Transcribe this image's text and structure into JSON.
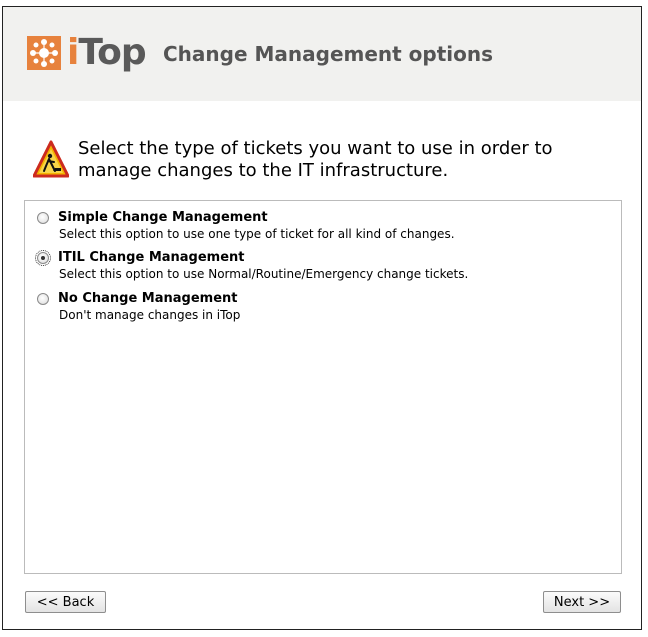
{
  "header": {
    "logo_text_i": "i",
    "logo_text_rest": "Top",
    "title": "Change Management options"
  },
  "intro": {
    "text": "Select the type of tickets you want to use in order to manage changes to the IT infrastructure."
  },
  "options": [
    {
      "title": "Simple Change Management",
      "description": "Select this option to use one type of ticket for all kind of changes.",
      "selected": false
    },
    {
      "title": "ITIL Change Management",
      "description": "Select this option to use Normal/Routine/Emergency change tickets.",
      "selected": true
    },
    {
      "title": "No Change Management",
      "description": "Don't manage changes in iTop",
      "selected": false
    }
  ],
  "buttons": {
    "back_label": "<< Back",
    "next_label": "Next >>"
  },
  "colors": {
    "brand_orange": "#e7823d",
    "header_bg": "#f1f1ef"
  },
  "icons": {
    "logo": "itop-logo-icon",
    "warning": "roadwork-warning-icon"
  }
}
